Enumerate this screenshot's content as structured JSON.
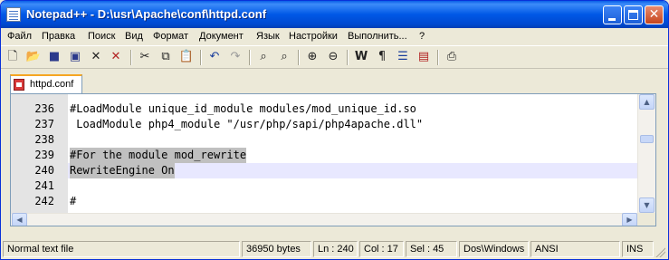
{
  "window": {
    "title": "Notepad++ - D:\\usr\\Apache\\conf\\httpd.conf"
  },
  "menu": [
    "Файл",
    "Правка",
    "Поиск",
    "Вид",
    "Формат",
    "Документ",
    "Язык",
    "Настройки",
    "Выполнить...",
    "?"
  ],
  "toolbar": {
    "icons": [
      "new-file-icon",
      "open-file-icon",
      "save-icon",
      "save-all-icon",
      "close-icon",
      "close-all-icon",
      "cut-icon",
      "copy-icon",
      "paste-icon",
      "undo-icon",
      "redo-icon",
      "find-icon",
      "replace-icon",
      "zoom-in-icon",
      "zoom-out-icon",
      "word-wrap-icon",
      "show-all-chars-icon",
      "indent-guide-icon",
      "user-language-icon",
      "print-icon"
    ]
  },
  "tab": {
    "label": "httpd.conf"
  },
  "editor": {
    "lines": [
      {
        "num": "236",
        "text": "#LoadModule unique_id_module modules/mod_unique_id.so"
      },
      {
        "num": "237",
        "text": " LoadModule php4_module \"/usr/php/sapi/php4apache.dll\""
      },
      {
        "num": "238",
        "text": ""
      },
      {
        "num": "239",
        "text": "#For the module mod_rewrite"
      },
      {
        "num": "240",
        "text": "RewriteEngine On"
      },
      {
        "num": "241",
        "text": ""
      },
      {
        "num": "242",
        "text": "#"
      }
    ],
    "current_line": "240",
    "selection_color": "#c0c0c0",
    "current_line_color": "#e8e8ff"
  },
  "status": {
    "file_type": "Normal text file",
    "size": "36950 bytes",
    "ln": "Ln : 240",
    "col": "Col : 17",
    "sel": "Sel : 45",
    "eol": "Dos\\Windows",
    "encoding": "ANSI",
    "mode": "INS"
  }
}
